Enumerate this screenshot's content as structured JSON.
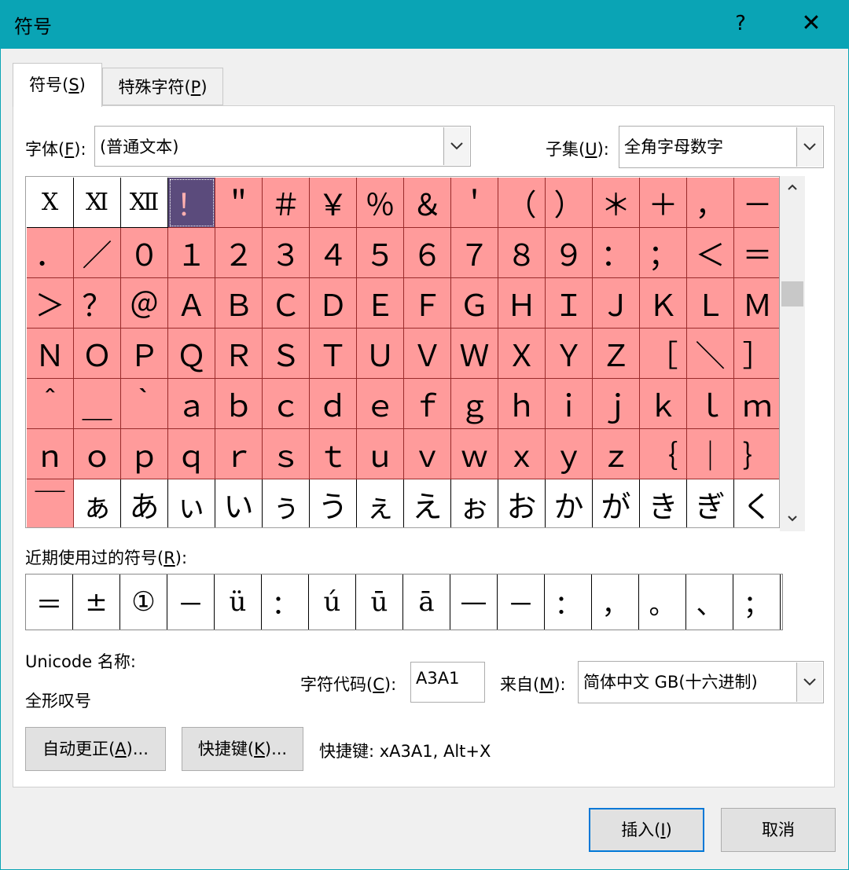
{
  "window": {
    "title": "符号",
    "help": "?",
    "close": "✕"
  },
  "tabs": [
    {
      "label": "符号(",
      "key": "S",
      "suffix": ")"
    },
    {
      "label": "特殊字符(",
      "key": "P",
      "suffix": ")"
    }
  ],
  "font": {
    "label_prefix": "字体(",
    "key": "F",
    "label_suffix": "):",
    "value": "(普通文本)"
  },
  "subset": {
    "label_prefix": "子集(",
    "key": "U",
    "label_suffix": "):",
    "value": "全角字母数字"
  },
  "symbol_grid": {
    "rows": [
      [
        "Ⅹ",
        "Ⅺ",
        "Ⅻ",
        "！",
        "＂",
        "＃",
        "￥",
        "％",
        "＆",
        "＇",
        "（",
        "）",
        "＊",
        "＋",
        "，",
        "－"
      ],
      [
        "．",
        "／",
        "０",
        "１",
        "２",
        "３",
        "４",
        "５",
        "６",
        "７",
        "８",
        "９",
        "：",
        "；",
        "＜",
        "＝"
      ],
      [
        "＞",
        "？",
        "＠",
        "Ａ",
        "Ｂ",
        "Ｃ",
        "Ｄ",
        "Ｅ",
        "Ｆ",
        "Ｇ",
        "Ｈ",
        "Ｉ",
        "Ｊ",
        "Ｋ",
        "Ｌ",
        "Ｍ"
      ],
      [
        "Ｎ",
        "Ｏ",
        "Ｐ",
        "Ｑ",
        "Ｒ",
        "Ｓ",
        "Ｔ",
        "Ｕ",
        "Ｖ",
        "Ｗ",
        "Ｘ",
        "Ｙ",
        "Ｚ",
        "［",
        "＼",
        "］"
      ],
      [
        "＾",
        "＿",
        "｀",
        "ａ",
        "ｂ",
        "ｃ",
        "ｄ",
        "ｅ",
        "ｆ",
        "ｇ",
        "ｈ",
        "ｉ",
        "ｊ",
        "ｋ",
        "ｌ",
        "ｍ"
      ],
      [
        "ｎ",
        "ｏ",
        "ｐ",
        "ｑ",
        "ｒ",
        "ｓ",
        "ｔ",
        "ｕ",
        "ｖ",
        "ｗ",
        "ｘ",
        "ｙ",
        "ｚ",
        "｛",
        "｜",
        "｝"
      ],
      [
        "￣",
        "ぁ",
        "あ",
        "ぃ",
        "い",
        "ぅ",
        "う",
        "ぇ",
        "え",
        "ぉ",
        "お",
        "か",
        "が",
        "き",
        "ぎ",
        "く"
      ]
    ]
  },
  "recent": {
    "label_prefix": "近期使用过的符号(",
    "key": "R",
    "label_suffix": "):",
    "symbols": [
      "＝",
      "±",
      "①",
      "－",
      "ü",
      "：",
      "ú",
      "ū",
      "ā",
      "—",
      "－",
      "：",
      "，",
      "。",
      "、",
      "；"
    ]
  },
  "unicode_name": {
    "label": "Unicode 名称:",
    "value": "全形叹号"
  },
  "char_code": {
    "label_prefix": "字符代码(",
    "key": "C",
    "label_suffix": "):",
    "value": "A3A1"
  },
  "from": {
    "label_prefix": "来自(",
    "key": "M",
    "label_suffix": "):",
    "value": "简体中文 GB(十六进制)"
  },
  "autocorrect_button": {
    "prefix": "自动更正(",
    "key": "A",
    "suffix": ")..."
  },
  "shortcut_button": {
    "prefix": "快捷键(",
    "key": "K",
    "suffix": ")..."
  },
  "shortcut_text": "快捷键: xA3A1, Alt+X",
  "insert_button": {
    "prefix": "插入(",
    "key": "I",
    "suffix": ")"
  },
  "cancel_button": {
    "label": "取消"
  },
  "colors": {
    "title_bar": "#0aa4b5",
    "highlight": "#ff9b9b",
    "selected": "#5b4b7c"
  }
}
